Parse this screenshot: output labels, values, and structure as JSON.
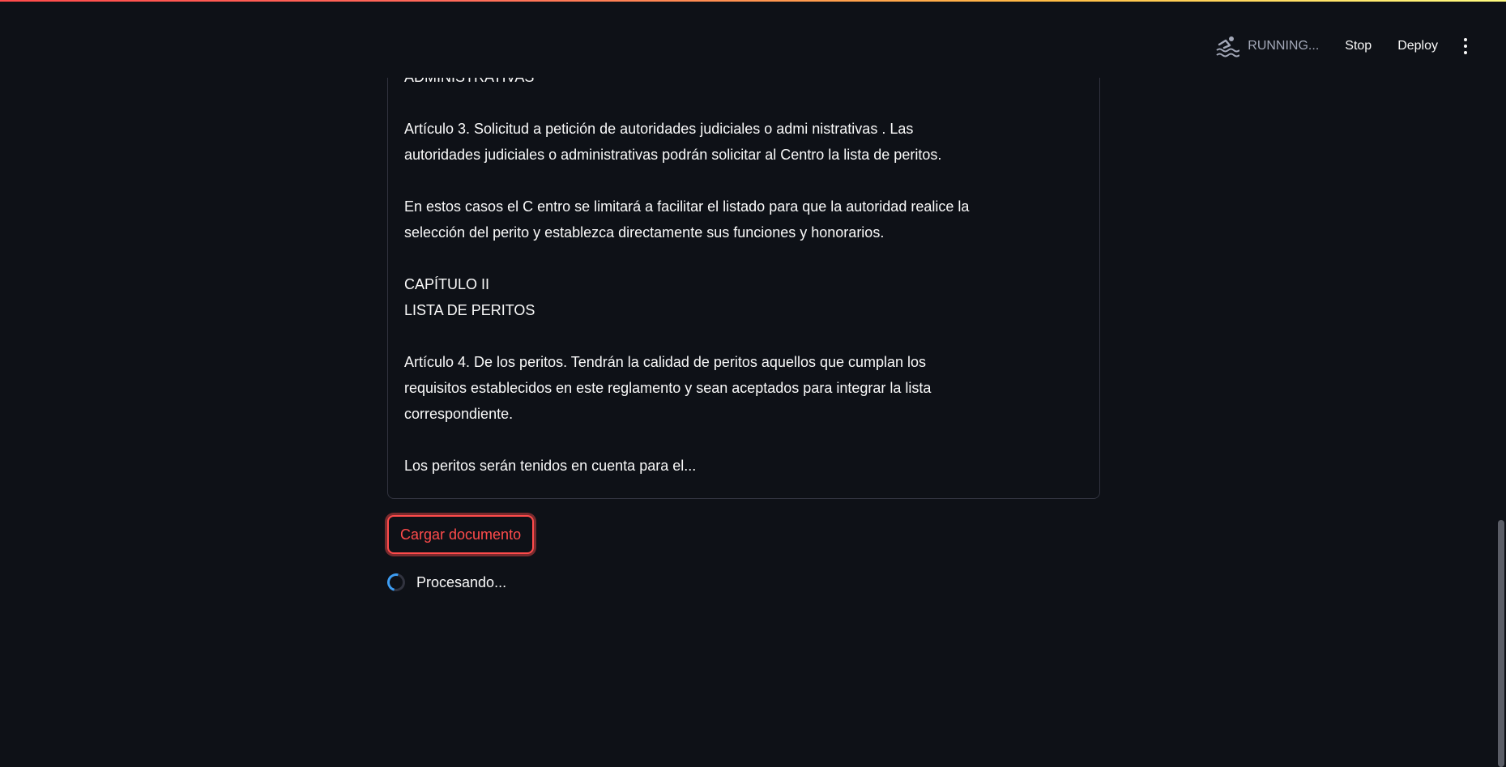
{
  "header": {
    "status_label": "RUNNING...",
    "stop_label": "Stop",
    "deploy_label": "Deploy",
    "status_icon": "swimmer-icon",
    "menu_icon": "vertical-dots-icon"
  },
  "document": {
    "paragraphs": [
      "ADMINISTRATIVAS",
      "Artículo 3. Solicitud a petición de autoridades judiciales o admi nistrativas . Las\nautoridades judiciales o administrativas podrán solicitar al Centro la lista de peritos.",
      "En estos casos el C entro se limitará a facilitar el listado para que la autoridad realice la\nselección del perito y establezca directamente sus funciones y honorarios.",
      "CAPÍTULO II\nLISTA DE PERITOS",
      "Artículo 4. De los peritos. Tendrán la calidad de peritos aquellos que cumplan los\nrequisitos establecidos en este reglamento y sean aceptados para integrar la lista\ncorrespondiente.",
      "Los peritos serán tenidos en cuenta para el..."
    ]
  },
  "actions": {
    "load_button_label": "Cargar documento"
  },
  "status": {
    "text": "Procesando...",
    "icon": "spinner-icon"
  },
  "colors": {
    "background": "#0e1117",
    "accent": "#ff4b4b",
    "spinner": "#3d9df3"
  }
}
